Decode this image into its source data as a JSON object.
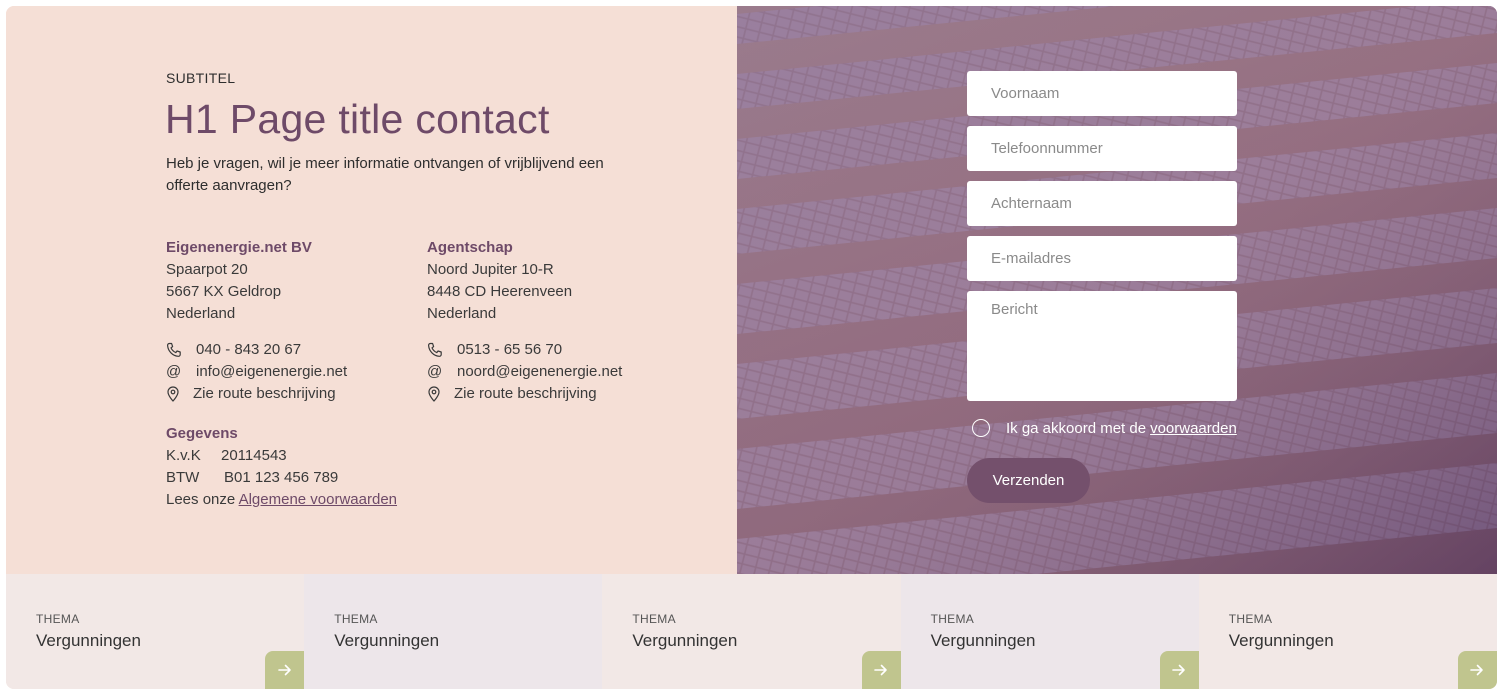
{
  "header": {
    "subtitle": "SUBTITEL",
    "title": "H1 Page title contact",
    "intro": "Heb je vragen, wil je meer informatie ontvangen of vrijblijvend een offerte aanvragen?"
  },
  "offices": [
    {
      "name": "Eigenenergie.net BV",
      "street": "Spaarpot 20",
      "city": "5667 KX Geldrop",
      "country": "Nederland",
      "phone": "040 - 843 20 67",
      "email": "info@eigenenergie.net",
      "route": "Zie route beschrijving"
    },
    {
      "name": "Agentschap",
      "street": "Noord Jupiter 10-R",
      "city": "8448 CD Heerenveen",
      "country": "Nederland",
      "phone": "0513 - 65 56 70",
      "email": "noord@eigenenergie.net",
      "route": "Zie route beschrijving"
    }
  ],
  "gegevens": {
    "heading": "Gegevens",
    "kvk_label": "K.v.K",
    "kvk_value": "20114543",
    "btw_label": "BTW",
    "btw_value": "B01 123 456 789",
    "terms_prefix": "Lees onze",
    "terms_link": "Algemene voorwaarden"
  },
  "form": {
    "firstname_placeholder": "Voornaam",
    "phone_placeholder": "Telefoonnummer",
    "lastname_placeholder": "Achternaam",
    "email_placeholder": "E-mailadres",
    "message_placeholder": "Bericht",
    "agree_text": "Ik ga akkoord met de",
    "agree_link": "voorwaarden",
    "submit_label": "Verzenden"
  },
  "themes": [
    {
      "label": "THEMA",
      "title": "Vergunningen",
      "bg": "#f2e8e6"
    },
    {
      "label": "THEMA",
      "title": "Vergunningen",
      "bg": "#ede6ea"
    },
    {
      "label": "THEMA",
      "title": "Vergunningen",
      "bg": "#f2e8e6"
    },
    {
      "label": "THEMA",
      "title": "Vergunningen",
      "bg": "#ede6ea"
    },
    {
      "label": "THEMA",
      "title": "Vergunningen",
      "bg": "#f2e8e6"
    }
  ],
  "colors": {
    "panel_bg": "#f5dfd6",
    "accent_purple": "#6e4a68",
    "button_bg": "#74506c",
    "arrow_bg": "#c0c58e"
  },
  "icons": {
    "phone": "phone-icon",
    "email": "at-icon",
    "route": "map-pin-icon",
    "arrow": "arrow-right-icon"
  }
}
